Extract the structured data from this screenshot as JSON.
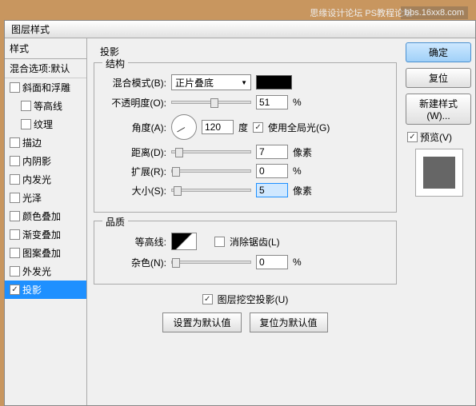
{
  "watermark": "bbs.16xx8.com",
  "watermark2": "思缘设计论坛    PS教程论坛",
  "titlebar": "图层样式",
  "left": {
    "header": "样式",
    "blend": "混合选项:默认",
    "items": [
      {
        "label": "斜面和浮雕",
        "checked": false,
        "indent": false
      },
      {
        "label": "等高线",
        "checked": false,
        "indent": true
      },
      {
        "label": "纹理",
        "checked": false,
        "indent": true
      },
      {
        "label": "描边",
        "checked": false,
        "indent": false
      },
      {
        "label": "内阴影",
        "checked": false,
        "indent": false
      },
      {
        "label": "内发光",
        "checked": false,
        "indent": false
      },
      {
        "label": "光泽",
        "checked": false,
        "indent": false
      },
      {
        "label": "颜色叠加",
        "checked": false,
        "indent": false
      },
      {
        "label": "渐变叠加",
        "checked": false,
        "indent": false
      },
      {
        "label": "图案叠加",
        "checked": false,
        "indent": false
      },
      {
        "label": "外发光",
        "checked": false,
        "indent": false
      },
      {
        "label": "投影",
        "checked": true,
        "indent": false,
        "selected": true
      }
    ]
  },
  "center": {
    "title": "投影",
    "struct": {
      "legend": "结构",
      "blendmode_label": "混合模式(B):",
      "blendmode_value": "正片叠底",
      "opacity_label": "不透明度(O):",
      "opacity_value": "51",
      "opacity_unit": "%",
      "angle_label": "角度(A):",
      "angle_value": "120",
      "angle_unit": "度",
      "global_label": "使用全局光(G)",
      "distance_label": "距离(D):",
      "distance_value": "7",
      "distance_unit": "像素",
      "spread_label": "扩展(R):",
      "spread_value": "0",
      "spread_unit": "%",
      "size_label": "大小(S):",
      "size_value": "5",
      "size_unit": "像素"
    },
    "quality": {
      "legend": "品质",
      "contour_label": "等高线:",
      "antialias_label": "消除锯齿(L)",
      "noise_label": "杂色(N):",
      "noise_value": "0",
      "noise_unit": "%"
    },
    "knockout": "图层挖空投影(U)",
    "default_set": "设置为默认值",
    "default_reset": "复位为默认值"
  },
  "right": {
    "ok": "确定",
    "cancel": "复位",
    "newstyle": "新建样式(W)...",
    "preview": "预览(V)"
  }
}
